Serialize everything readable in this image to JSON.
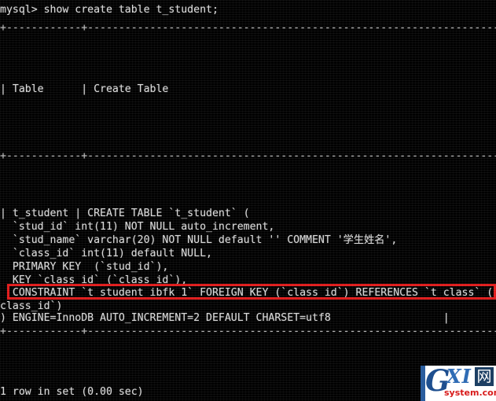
{
  "terminal": {
    "prompt_line": "mysql> show create table t_student;",
    "separator_top": "+------------+------------------------------------------------------------------+",
    "header_row": "| Table      | Create Table                                                     |",
    "separator_mid": "+------------+------------------------------------------------------------------+",
    "result_lines": [
      "| t_student | CREATE TABLE `t_student` (",
      "  `stud_id` int(11) NOT NULL auto_increment,",
      "  `stud_name` varchar(20) NOT NULL default '' COMMENT '学生姓名',",
      "  `class_id` int(11) default NULL,",
      "  PRIMARY KEY  (`stud_id`),",
      "  KEY `class_id` (`class_id`),",
      "  CONSTRAINT `t_student_ibfk_1` FOREIGN KEY (`class_id`) REFERENCES `t_class` (`",
      "class_id`)",
      ") ENGINE=InnoDB AUTO_INCREMENT=2 DEFAULT CHARSET=utf8                  |"
    ],
    "separator_bottom": "+------------+------------------------------------------------------------------+",
    "status_line": "1 row in set (0.00 sec)",
    "highlight_color": "#e01b1b",
    "text_color": "#d8d8d8",
    "background_color": "#000000"
  },
  "watermark": {
    "letter_g": "G",
    "letters_xi": "XI",
    "cjk_char": "网",
    "domain": "system.com"
  }
}
